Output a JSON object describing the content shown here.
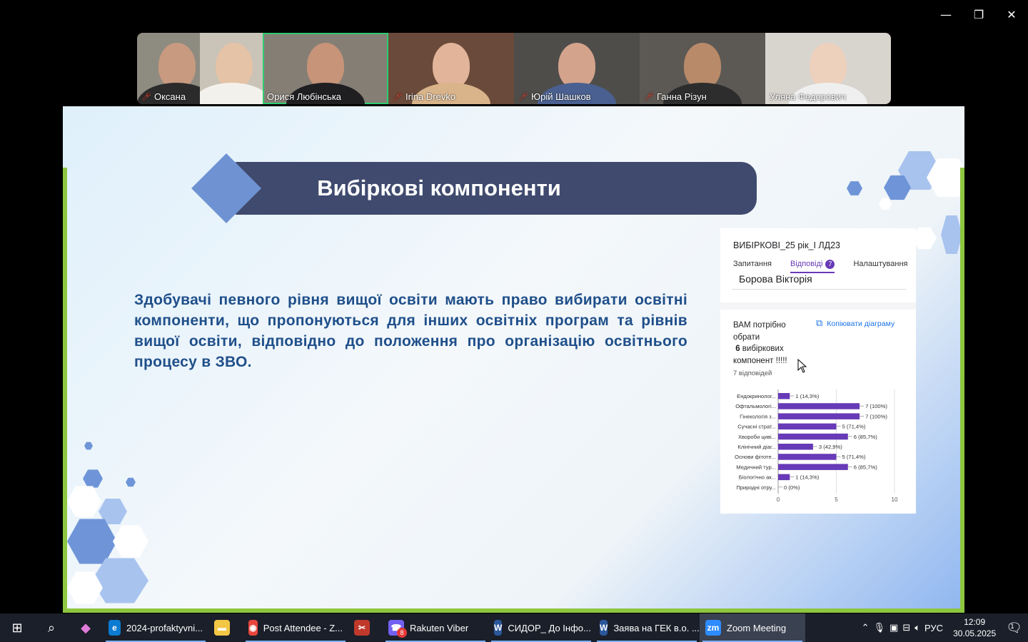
{
  "window": {
    "minimize": "—",
    "restore": "❐",
    "close": "✕"
  },
  "participants": [
    {
      "name": "Оксана",
      "muted": true
    },
    {
      "name": "",
      "muted": false
    },
    {
      "name": "Орися Любінська",
      "muted": false,
      "active": true
    },
    {
      "name": "Irina Drevko",
      "muted": true
    },
    {
      "name": "Юрій Шашков",
      "muted": true
    },
    {
      "name": "Ганна Різун",
      "muted": true
    },
    {
      "name": "Уляна Федорович",
      "muted": false
    }
  ],
  "slide": {
    "title": "Вибіркові компоненти",
    "body": "Здобувачі певного рівня вищої освіти мають право вибирати освітні компоненти, що пропонуються для інших освітніх програм та рівнів вищої освіти, відповідно до положення про організацію освітнього процесу в ЗВО."
  },
  "form": {
    "title": "ВИБІРКОВІ_25 рік_І ЛД23",
    "tabs": {
      "questions": "Запитання",
      "responses": "Відповіді",
      "responses_count": "7",
      "settings": "Налаштування"
    },
    "respondent": "Борова Вікторія",
    "question_line1": "ВАМ потрібно обрати",
    "question_number": "6",
    "question_line2": " вибіркових компонент !!!!!",
    "response_count": "7 відповідей",
    "copy_label": "Копіювати діаграму"
  },
  "chart_data": {
    "type": "bar",
    "orientation": "horizontal",
    "categories": [
      "Ендокринолог...",
      "Офтальмологі...",
      "Гінекологія з...",
      "Сучасні страт...",
      "Хвороби циві...",
      "Клінічний діаг...",
      "Основи фітоте...",
      "Медичний тур...",
      "Біологічно ак...",
      "Природні отру..."
    ],
    "values": [
      1,
      7,
      7,
      5,
      6,
      3,
      5,
      6,
      1,
      0
    ],
    "data_labels": [
      "1 (14,3%)",
      "7 (100%)",
      "7 (100%)",
      "5 (71,4%)",
      "6 (85,7%)",
      "3 (42,9%)",
      "5 (71,4%)",
      "6 (85,7%)",
      "1 (14,3%)",
      "0 (0%)"
    ],
    "xlim": [
      0,
      10
    ],
    "xticks": [
      "0",
      "5",
      "10"
    ],
    "bar_color": "#673ab7",
    "grid": true
  },
  "taskbar": {
    "apps": [
      {
        "label": "2024-profaktyvni...",
        "icon": "edge-icon",
        "color": "#0c7bd1",
        "glyph": "e"
      },
      {
        "label": "",
        "icon": "folder-icon",
        "color": "#f2c744",
        "glyph": "▬"
      },
      {
        "label": "Post Attendee - Z...",
        "icon": "chrome-icon",
        "color": "#e8453c",
        "glyph": "◉"
      },
      {
        "label": "",
        "icon": "snipping-icon",
        "color": "#c0392b",
        "glyph": "✂"
      },
      {
        "label": "Rakuten Viber",
        "icon": "viber-icon",
        "color": "#7360f2",
        "glyph": "☎",
        "badge": "8"
      },
      {
        "label": "СИДОР_ До Інфо...",
        "icon": "word-icon",
        "color": "#2b579a",
        "glyph": "W"
      },
      {
        "label": "Заява на ГЕК в.о. ...",
        "icon": "word-icon",
        "color": "#2b579a",
        "glyph": "W"
      },
      {
        "label": "Zoom Meeting",
        "icon": "zoom-icon",
        "color": "#2d8cff",
        "glyph": "zm"
      }
    ],
    "language": "РУС",
    "time": "12:09",
    "date": "30.05.2025",
    "notifications": "1"
  }
}
